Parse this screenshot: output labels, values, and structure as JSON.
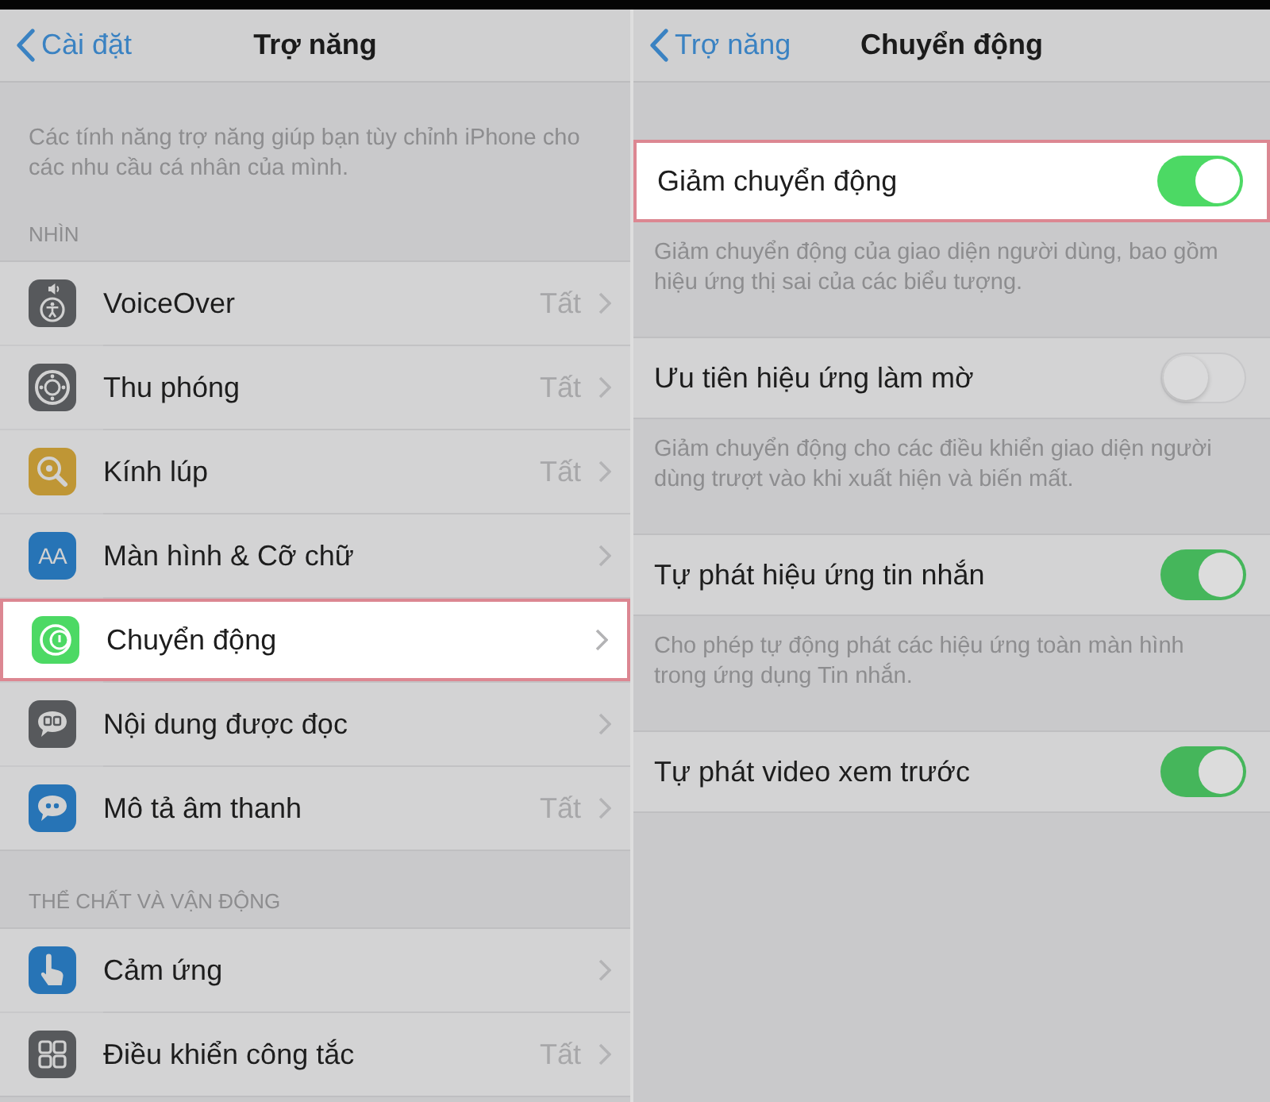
{
  "left_panel": {
    "nav": {
      "back": "Cài đặt",
      "title": "Trợ năng"
    },
    "description": "Các tính năng trợ năng giúp bạn tùy chỉnh iPhone cho các nhu cầu cá nhân của mình.",
    "sections": [
      {
        "header": "NHÌN",
        "items": [
          {
            "label": "VoiceOver",
            "value": "Tất",
            "highlighted": false
          },
          {
            "label": "Thu phóng",
            "value": "Tất",
            "highlighted": false
          },
          {
            "label": "Kính lúp",
            "value": "Tất",
            "highlighted": false
          },
          {
            "label": "Màn hình & Cỡ chữ",
            "icon_text": "AA",
            "highlighted": false
          },
          {
            "label": "Chuyển động",
            "highlighted": true
          },
          {
            "label": "Nội dung được đọc",
            "highlighted": false
          },
          {
            "label": "Mô tả âm thanh",
            "value": "Tất",
            "highlighted": false
          }
        ]
      },
      {
        "header": "THỂ CHẤT VÀ VẬN ĐỘNG",
        "items": [
          {
            "label": "Cảm ứng",
            "highlighted": false
          },
          {
            "label": "Điều khiển công tắc",
            "value": "Tất",
            "highlighted": false
          }
        ]
      }
    ]
  },
  "right_panel": {
    "nav": {
      "back": "Trợ năng",
      "title": "Chuyển động"
    },
    "settings": [
      {
        "label": "Giảm chuyển động",
        "on": true,
        "highlighted": true,
        "footer": "Giảm chuyển động của giao diện người dùng, bao gồm hiệu ứng thị sai của các biểu tượng."
      },
      {
        "label": "Ưu tiên hiệu ứng làm mờ",
        "on": false,
        "highlighted": false,
        "footer": "Giảm chuyển động cho các điều khiển giao diện người dùng trượt vào khi xuất hiện và biến mất."
      },
      {
        "label": "Tự phát hiệu ứng tin nhắn",
        "on": true,
        "highlighted": false,
        "footer": "Cho phép tự động phát các hiệu ứng toàn màn hình trong ứng dụng Tin nhắn."
      },
      {
        "label": "Tự phát video xem trước",
        "on": true,
        "highlighted": false
      }
    ]
  }
}
